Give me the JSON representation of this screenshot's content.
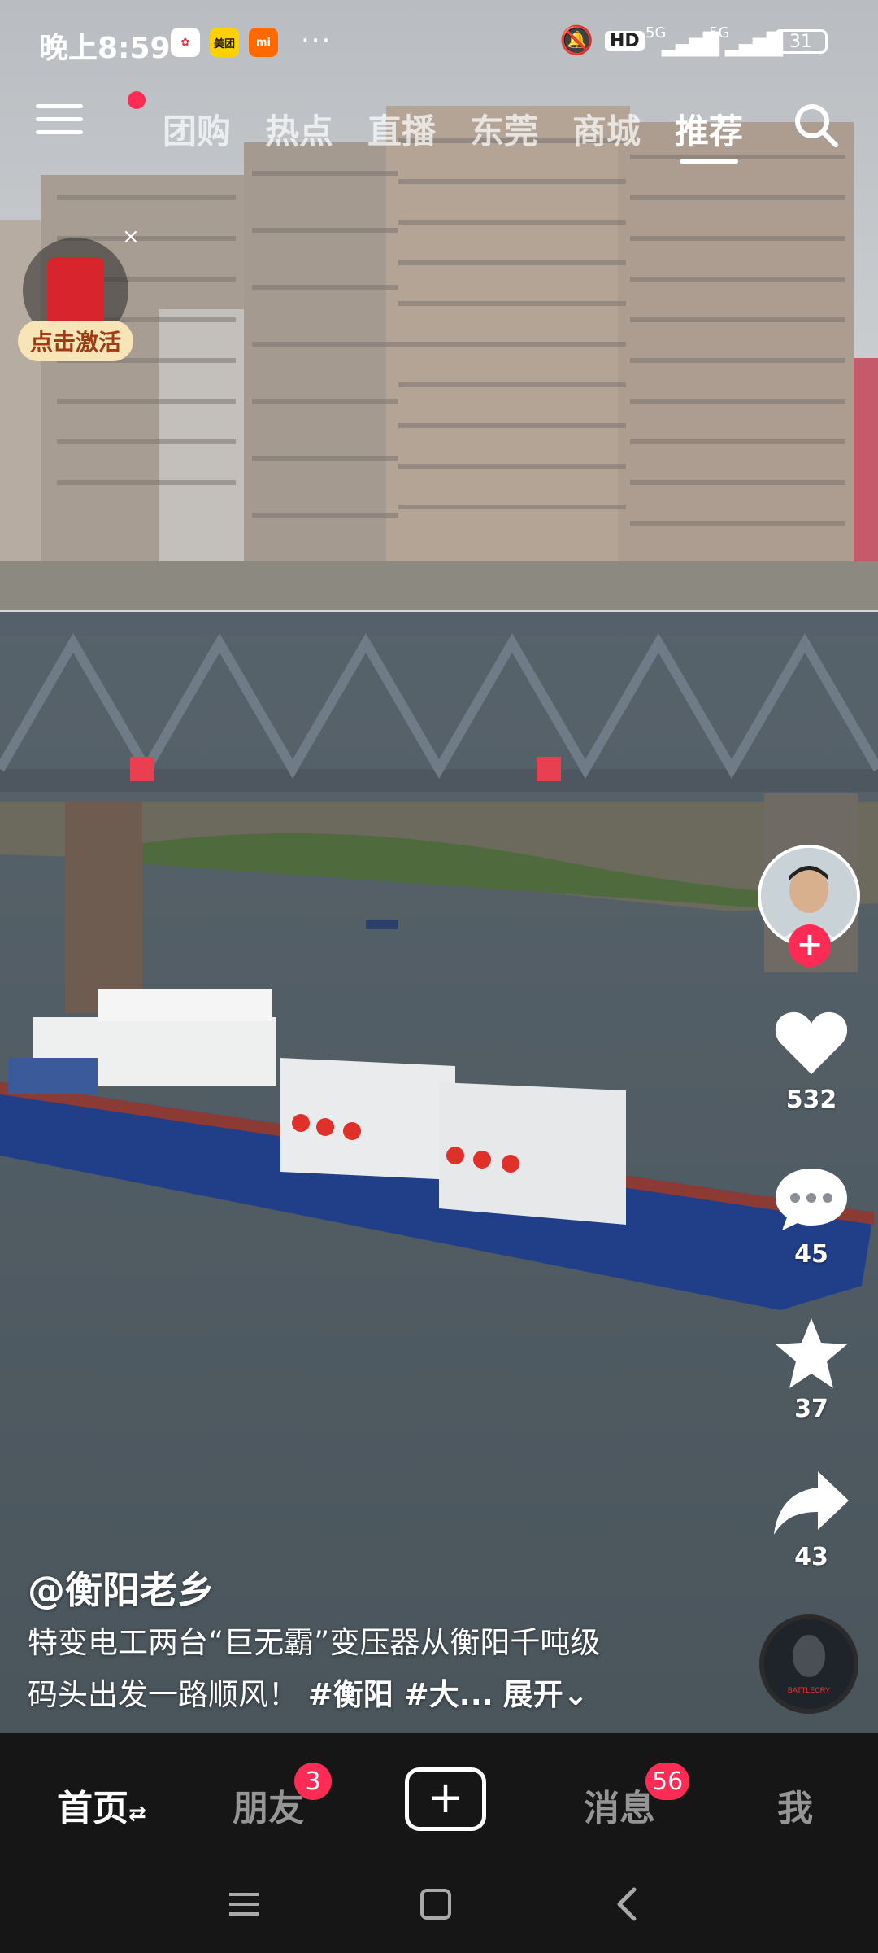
{
  "status_bar": {
    "time": "晚上8:59",
    "app_badges": [
      "美团",
      "mi"
    ],
    "more": "···",
    "hd": "HD",
    "net1": "5G",
    "net2": "5G",
    "battery": "31"
  },
  "top_nav": {
    "tabs": [
      "团购",
      "热点",
      "直播",
      "东莞",
      "商城",
      "推荐"
    ],
    "active_tab": "推荐"
  },
  "red_envelope": {
    "label": "点击激活",
    "close": "×"
  },
  "actions": {
    "follow": "+",
    "likes": "532",
    "comments": "45",
    "favorites": "37",
    "shares": "43"
  },
  "caption": {
    "author": "@衡阳老乡",
    "line1": "特变电工两台“巨无霸”变压器从衡阳千吨级",
    "line2_text": "码头出发一路顺风！",
    "hashtags": "#衡阳 #大...",
    "expand": "展开"
  },
  "bottom_tabs": {
    "home": "首页",
    "friends": "朋友",
    "friends_badge": "3",
    "create": "+",
    "messages": "消息",
    "messages_badge": "56",
    "me": "我"
  },
  "music_disc_text": "BATTLECRY",
  "colors": {
    "accent": "#fe2c55",
    "tabbar_bg": "#161616"
  }
}
